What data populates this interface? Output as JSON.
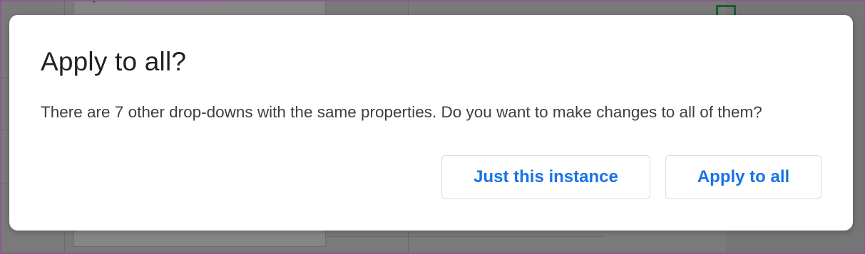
{
  "dialog": {
    "title": "Apply to all?",
    "message": "There are 7 other drop-downs with the same properties. Do you want to make changes to all of them?",
    "buttons": {
      "just_this_instance": "Just this instance",
      "apply_to_all": "Apply to all"
    }
  },
  "colors": {
    "accent": "#1a73e8",
    "title_text": "#202124",
    "body_text": "#3c4043",
    "button_border": "#dadce0",
    "overlay": "#7a7a7a",
    "frame": "#8a5a93"
  }
}
